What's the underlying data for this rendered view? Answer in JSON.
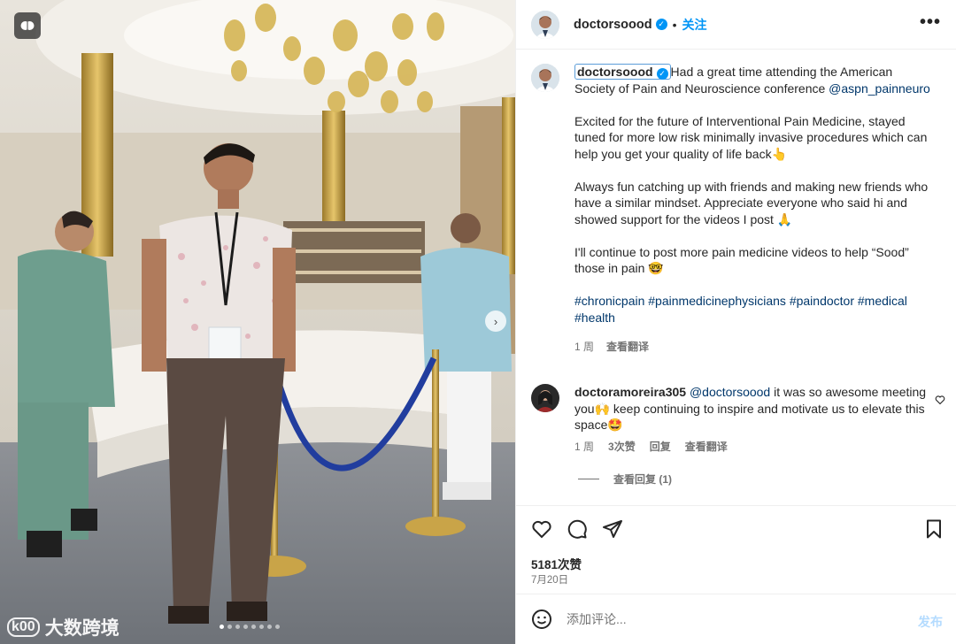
{
  "post": {
    "username": "doctorsoood",
    "separator": "•",
    "follow_label": "关注",
    "more_label": "•••",
    "caption": {
      "username": "doctorsoood",
      "p1_text": "Had a great time attending the American Society of Pain and Neuroscience conference ",
      "p1_mention": "@aspn_painneuro",
      "p2": "Excited for the future of Interventional Pain Medicine, stayed tuned for more low risk minimally invasive procedures which can help you get your quality of life back👆",
      "p3": "Always fun catching up with friends and making new friends who have a similar mindset. Appreciate everyone who said hi and showed support for the videos I post 🙏",
      "p4": "I'll continue to post more pain medicine videos to help “Sood” those in pain 🤓",
      "hashtags": "#chronicpain #painmedicinephysicians #paindoctor #medical #health",
      "time": "1 周",
      "translate": "查看翻译"
    },
    "comment": {
      "username": "doctoramoreira305",
      "mention": "@doctorsoood",
      "text": " it was so awesome meeting you🙌 keep continuing to inspire and motivate us to elevate this space🤩",
      "time": "1 周",
      "likes": "3次赞",
      "reply": "回复",
      "translate": "查看翻译",
      "view_replies": "查看回复 (1)"
    },
    "likes_count": "5181次赞",
    "date": "7月20日",
    "add_comment_placeholder": "添加评论...",
    "post_button": "发布"
  },
  "photo": {
    "carousel_count": 8,
    "carousel_active": 1,
    "next_arrow": "›",
    "watermark_logo": "k00",
    "watermark_text": "大数跨境"
  },
  "colors": {
    "accent": "#0095f6",
    "link": "#00376b",
    "muted": "#737373"
  },
  "icons": [
    "brain-icon",
    "verified-icon",
    "more-icon",
    "heart-icon",
    "comment-icon",
    "share-icon",
    "bookmark-icon",
    "emoji-icon",
    "chevron-right-icon"
  ]
}
